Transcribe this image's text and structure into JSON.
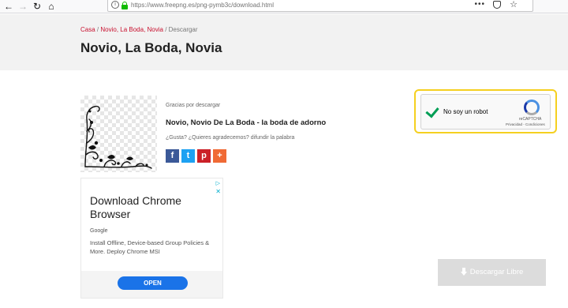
{
  "browser": {
    "url_display": "https://www.freepng.es/png-pymb3c/download.html",
    "back_glyph": "←",
    "forward_glyph": "→",
    "reload_glyph": "↻",
    "home_glyph": "⌂",
    "info_glyph": "i",
    "menu_glyph": "•••",
    "star_glyph": "☆"
  },
  "breadcrumb": {
    "home": "Casa",
    "sep1": " / ",
    "category": "Novio, La Boda, Novia",
    "sep2": " / ",
    "current": "Descargar"
  },
  "page": {
    "title": "Novio, La Boda, Novia",
    "thanks_text": "Gracias por descargar",
    "item_title": "Novio, Novio De La Boda - la boda de adorno",
    "share_prompt": "¿Gusta? ¿Quieres agradecemos? difundir la palabra"
  },
  "social": {
    "facebook_glyph": "f",
    "twitter_glyph": "t",
    "pinterest_glyph": "p",
    "more_glyph": "+"
  },
  "ad": {
    "choices_glyph": "▷",
    "close_glyph": "✕",
    "headline": "Download Chrome Browser",
    "source": "Google",
    "description": "Install Offline, Device-based Group Policies & More. Deploy Chrome MSI",
    "cta": "OPEN"
  },
  "captcha": {
    "label": "No soy un robot",
    "brand": "reCAPTCHA",
    "terms": "Privacidad - Condiciones"
  },
  "download": {
    "label": "Descargar Libre"
  },
  "colors": {
    "accent_red": "#c8102e",
    "captcha_highlight": "#f5d020",
    "cta_blue": "#1a73e8"
  }
}
